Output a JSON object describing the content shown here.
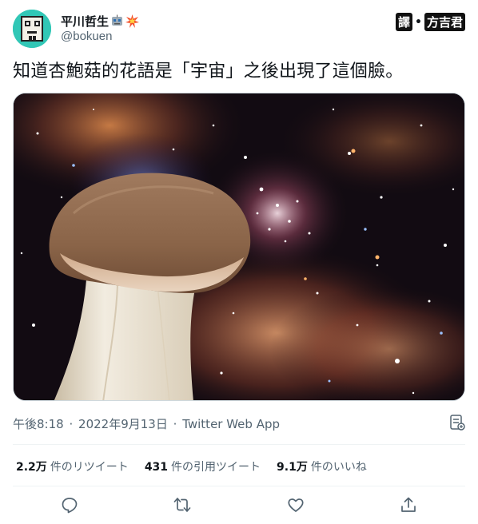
{
  "author": {
    "display_name": "平川哲生",
    "handle": "@bokuen",
    "name_emojis": [
      "robot-emoji-icon",
      "collision-emoji-icon"
    ]
  },
  "translator_tag": {
    "label_left": "譯",
    "separator": "•",
    "label_right": "方吉君"
  },
  "tweet": {
    "text": "知道杏鮑菇的花語是「宇宙」之後出現了這個臉。",
    "media_description_icon": "mushroom-in-galaxy-image"
  },
  "meta": {
    "time": "午後8:18",
    "separator": "·",
    "date": "2022年9月13日",
    "app": "Twitter Web App"
  },
  "stats": {
    "retweets_num": "2.2万",
    "retweets_label": "件のリツイート",
    "quotes_num": "431",
    "quotes_label": "件の引用ツイート",
    "likes_num": "9.1万",
    "likes_label": "件のいいね"
  },
  "actions": {
    "icons": [
      "reply-icon",
      "retweet-icon",
      "like-icon",
      "share-icon"
    ]
  },
  "colors": {
    "text_primary": "#0f1419",
    "text_secondary": "#536471",
    "divider": "#eff3f4",
    "avatar_bg": "#31c7b6"
  }
}
